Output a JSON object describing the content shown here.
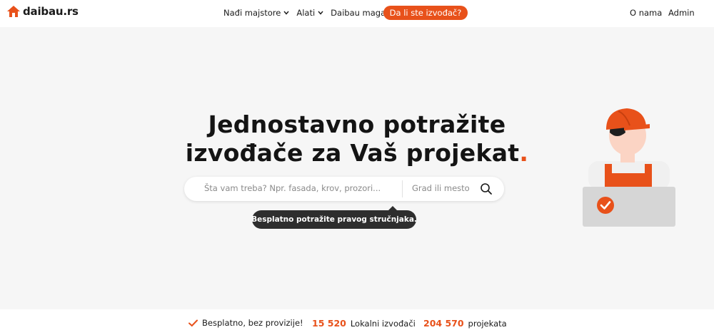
{
  "brand": {
    "name": "daibau.rs",
    "accent_color": "#e8511a",
    "logo_icon": "house-icon"
  },
  "nav": {
    "items": [
      {
        "label": "Nađi majstore",
        "icon": "chevron-down-icon"
      },
      {
        "label": "Alati",
        "icon": "chevron-down-icon"
      },
      {
        "label": "Daibau magazin"
      }
    ],
    "cta_label": "Da li ste izvođač?",
    "right_links": [
      "O nama",
      "Admin"
    ]
  },
  "hero": {
    "title_line1": "Jednostavno potražite",
    "title_line2": "izvođače za Vaš projekat",
    "title_dot": ".",
    "search": {
      "query_placeholder": "Šta vam treba? Npr. fasada, krov, prozori...",
      "location_placeholder": "Grad ili mesto",
      "icon": "search-icon"
    },
    "tooltip": "Besplatno potražite pravog stručnjaka."
  },
  "stats": {
    "free_label": "Besplatno, bez provizije!",
    "contractors_count": "15 520",
    "contractors_label": "Lokalni izvođači",
    "projects_count": "204 570",
    "projects_label": "projekata"
  }
}
